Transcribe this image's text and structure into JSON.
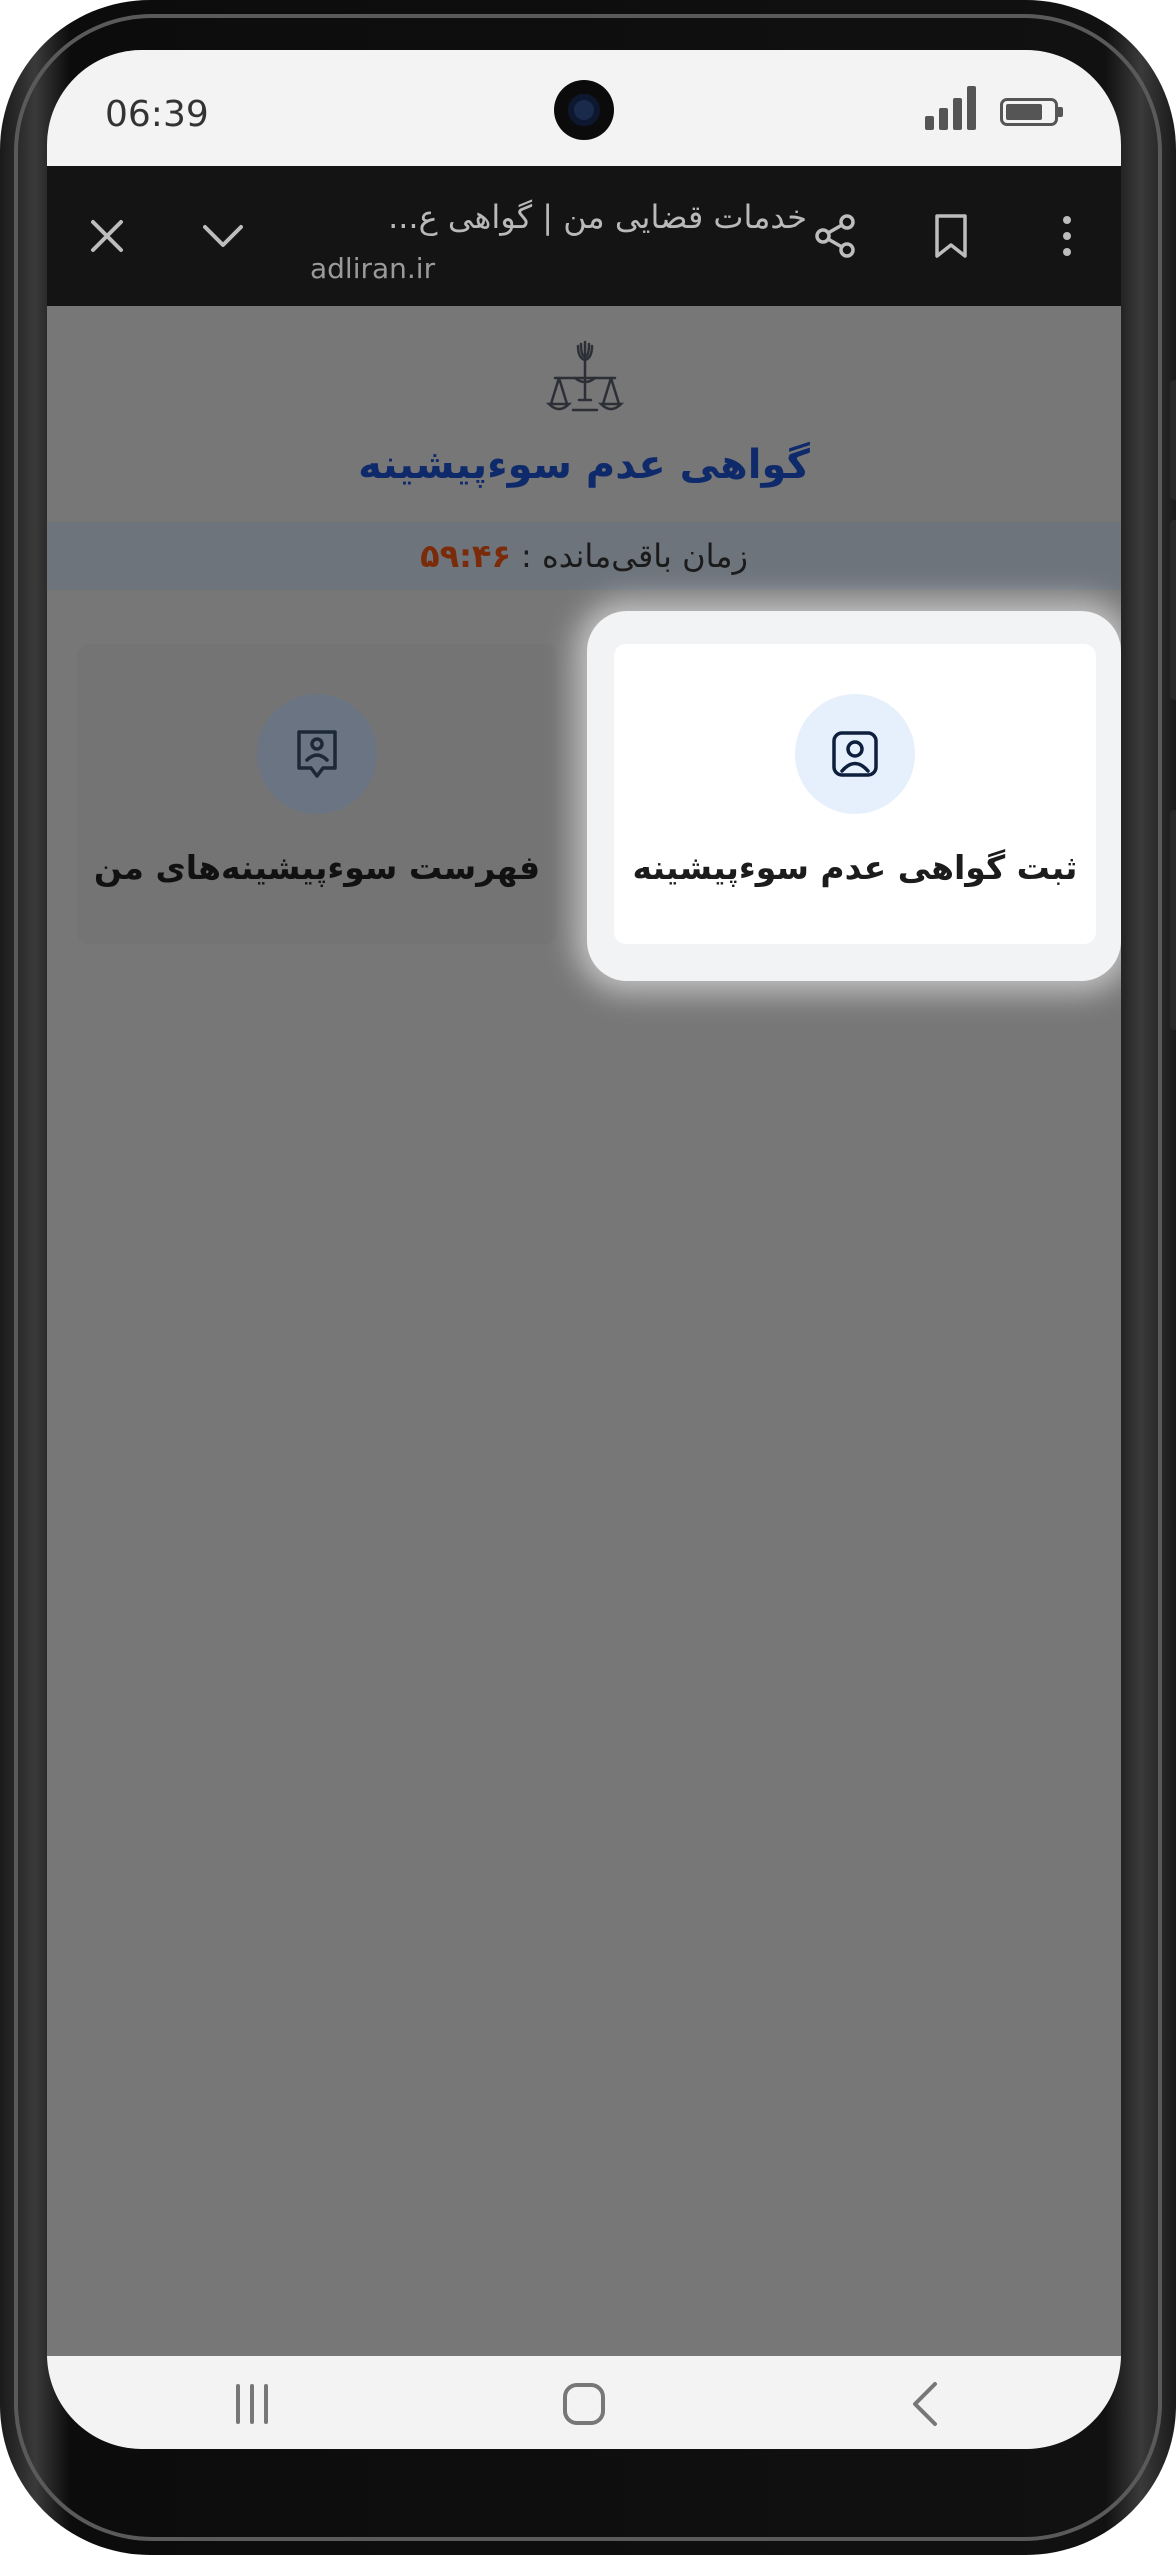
{
  "status_bar": {
    "time": "06:39",
    "icons": [
      "camera-icon",
      "signal-icon",
      "battery-icon"
    ]
  },
  "browser": {
    "title": "خدمات قضایی من | گواهی ع...",
    "url": "adliran.ir",
    "icons": [
      "close-icon",
      "chevron-down-icon",
      "share-icon",
      "bookmark-icon",
      "more-vert-icon"
    ]
  },
  "page": {
    "emblem": "iran-emblem-scales-icon",
    "title": "گواهی عدم سوءپیشینه",
    "timer": {
      "label": "زمان باقی‌مانده :",
      "value": "۵۹:۴۶"
    },
    "cards": [
      {
        "label": "ثبت گواهی عدم سوءپیشینه",
        "icon": "user-portrait-icon",
        "highlighted": true
      },
      {
        "label": "فهرست سوءپیشینه‌های من",
        "icon": "user-badge-icon",
        "highlighted": false
      }
    ]
  },
  "nav_bar": {
    "buttons": [
      "recent-apps-icon",
      "home-icon",
      "back-icon"
    ]
  },
  "colors": {
    "overlay": "#777777",
    "title": "#0f2a6b",
    "timer_value": "#7a2c0a",
    "browser_bar": "#141414"
  }
}
